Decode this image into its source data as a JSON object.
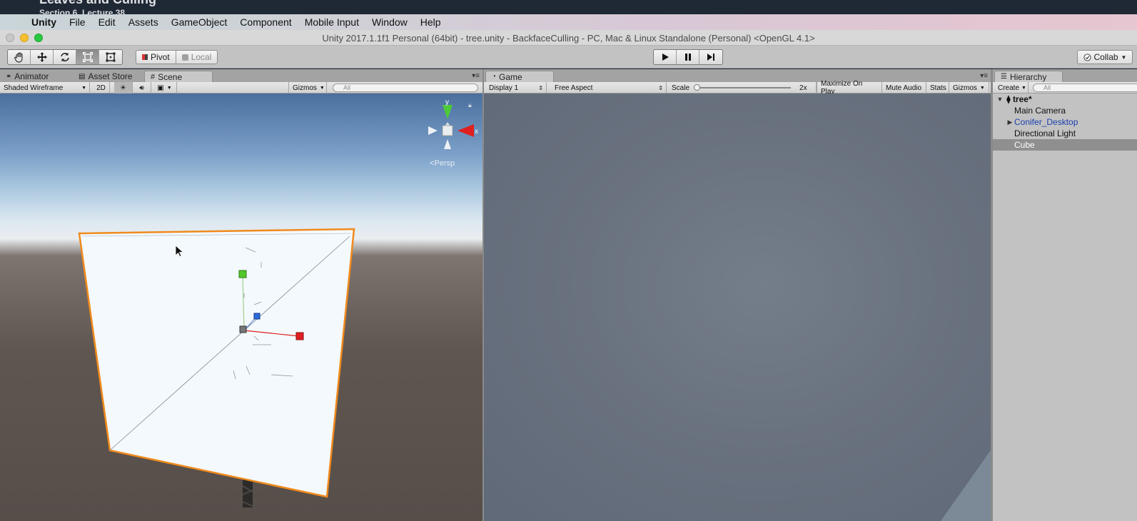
{
  "overlay": {
    "title": "Leaves and Culling",
    "subtitle": "Section 6, Lecture 38"
  },
  "menubar": {
    "apple_icon": "apple-icon",
    "items": [
      "Unity",
      "File",
      "Edit",
      "Assets",
      "GameObject",
      "Component",
      "Mobile Input",
      "Window",
      "Help"
    ]
  },
  "window": {
    "title": "Unity 2017.1.1f1 Personal (64bit) - tree.unity - BackfaceCulling - PC, Mac & Linux Standalone (Personal) <OpenGL 4.1>"
  },
  "toolbar": {
    "tools": [
      "hand-icon",
      "move-icon",
      "rotate-icon",
      "scale-icon",
      "rect-icon"
    ],
    "pivot_label": "Pivot",
    "local_label": "Local",
    "collab_label": "Collab"
  },
  "scene_panel": {
    "tabs": [
      "Animator",
      "Asset Store",
      "Scene"
    ],
    "draw_mode": "Shaded Wireframe",
    "mode_2d": "2D",
    "gizmos_label": "Gizmos",
    "search_placeholder": "All",
    "persp_label": "Persp",
    "axis_y": "y",
    "axis_x": "x"
  },
  "game_panel": {
    "tab": "Game",
    "display": "Display 1",
    "aspect": "Free Aspect",
    "scale_label": "Scale",
    "scale_value": "2x",
    "maximize_label": "Maximize On Play",
    "mute_label": "Mute Audio",
    "stats_label": "Stats",
    "gizmos_label": "Gizmos"
  },
  "hierarchy": {
    "tab": "Hierarchy",
    "create_label": "Create",
    "search_placeholder": "All",
    "scene_name": "tree*",
    "items": [
      {
        "label": "Main Camera",
        "prefab": false,
        "expandable": false,
        "selected": false
      },
      {
        "label": "Conifer_Desktop",
        "prefab": true,
        "expandable": true,
        "selected": false
      },
      {
        "label": "Directional Light",
        "prefab": false,
        "expandable": false,
        "selected": false
      },
      {
        "label": "Cube",
        "prefab": false,
        "expandable": false,
        "selected": true
      }
    ]
  },
  "colors": {
    "selection_outline": "#f08a1c",
    "prefab_text": "#1a3fb0",
    "axis_x": "#e02020",
    "axis_y": "#40c020",
    "axis_z": "#2a6be0"
  }
}
